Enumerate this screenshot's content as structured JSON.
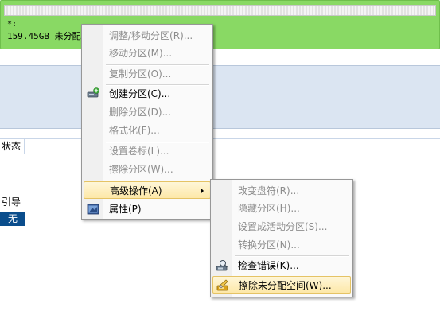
{
  "disk": {
    "label_line1": "*:",
    "label_line2": "159.45GB 未分配"
  },
  "table": {
    "header_status": "状态",
    "row_label": "引导",
    "row_value": "无"
  },
  "context_menu": {
    "items": [
      {
        "label": "调整/移动分区(R)...",
        "enabled": false
      },
      {
        "label": "移动分区(M)...",
        "enabled": false
      },
      {
        "label": "复制分区(O)...",
        "enabled": false
      },
      {
        "label": "创建分区(C)...",
        "enabled": true,
        "icon": "create-partition-icon"
      },
      {
        "label": "删除分区(D)...",
        "enabled": false
      },
      {
        "label": "格式化(F)...",
        "enabled": false
      },
      {
        "label": "设置卷标(L)...",
        "enabled": false
      },
      {
        "label": "擦除分区(W)...",
        "enabled": false
      },
      {
        "label": "高级操作(A)",
        "enabled": true,
        "highlighted": true,
        "submenu": true
      },
      {
        "label": "属性(P)",
        "enabled": true,
        "icon": "properties-icon"
      }
    ]
  },
  "submenu": {
    "items": [
      {
        "label": "改变盘符(R)...",
        "enabled": false
      },
      {
        "label": "隐藏分区(H)...",
        "enabled": false
      },
      {
        "label": "设置成活动分区(S)...",
        "enabled": false
      },
      {
        "label": "转换分区(N)...",
        "enabled": false
      },
      {
        "label": "检查错误(K)...",
        "enabled": true,
        "icon": "check-errors-icon"
      },
      {
        "label": "擦除未分配空间(W)...",
        "enabled": true,
        "highlighted": true,
        "icon": "wipe-unallocated-icon"
      }
    ]
  },
  "colors": {
    "disk_unallocated": "#89d964",
    "highlight": "#fde8a8",
    "selection": "#0a4d8c"
  }
}
